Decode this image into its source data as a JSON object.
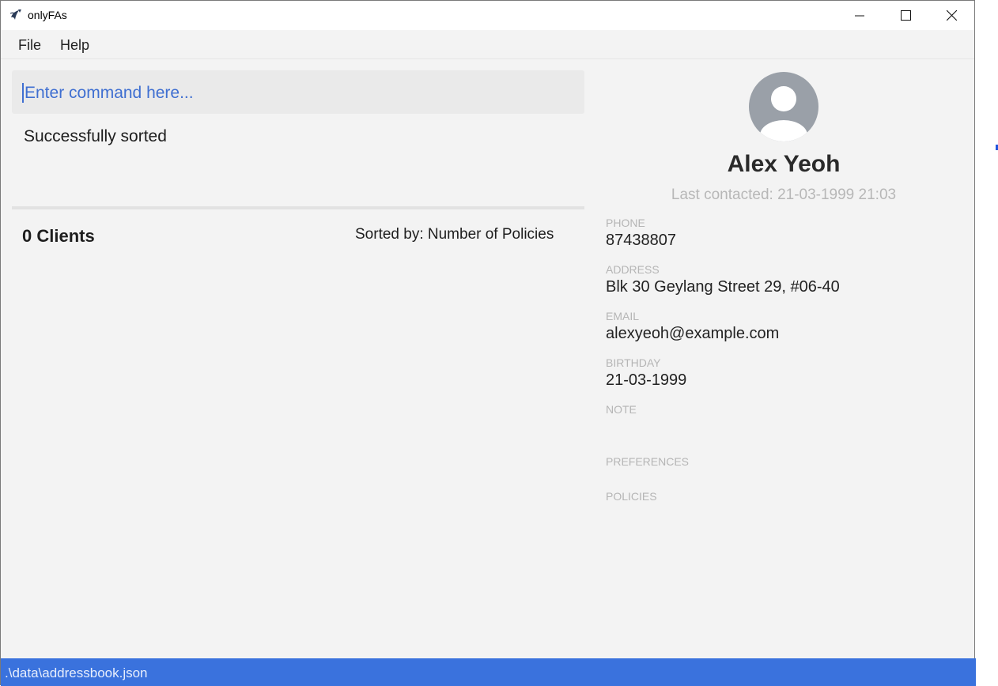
{
  "window": {
    "title": "onlyFAs",
    "icon": "app-logo-icon",
    "controls": [
      "minimize-icon",
      "maximize-icon",
      "close-icon"
    ]
  },
  "menu": {
    "items": [
      {
        "label": "File"
      },
      {
        "label": "Help"
      }
    ]
  },
  "command": {
    "placeholder": "Enter command here...",
    "value": ""
  },
  "result": {
    "message": "Successfully sorted"
  },
  "client_list": {
    "count_label": "0 Clients",
    "sorted_by_label": "Sorted by: Number of Policies"
  },
  "detail": {
    "avatar_icon": "user-avatar-icon",
    "name": "Alex Yeoh",
    "last_contacted": "Last contacted: 21-03-1999 21:03",
    "fields": [
      {
        "label": "PHONE",
        "value": "87438807"
      },
      {
        "label": "ADDRESS",
        "value": "Blk 30 Geylang Street 29, #06-40"
      },
      {
        "label": "EMAIL",
        "value": "alexyeoh@example.com"
      },
      {
        "label": "BIRTHDAY",
        "value": "21-03-1999"
      },
      {
        "label": "NOTE",
        "value": ""
      },
      {
        "label": "PREFERENCES",
        "value": ""
      },
      {
        "label": "POLICIES",
        "value": ""
      }
    ]
  },
  "status_bar": {
    "path": ".\\data\\addressbook.json"
  },
  "colors": {
    "accent": "#3a72dd",
    "command_text": "#3f6fd1",
    "background": "#f3f3f3",
    "label_gray": "#b5b5b5"
  }
}
